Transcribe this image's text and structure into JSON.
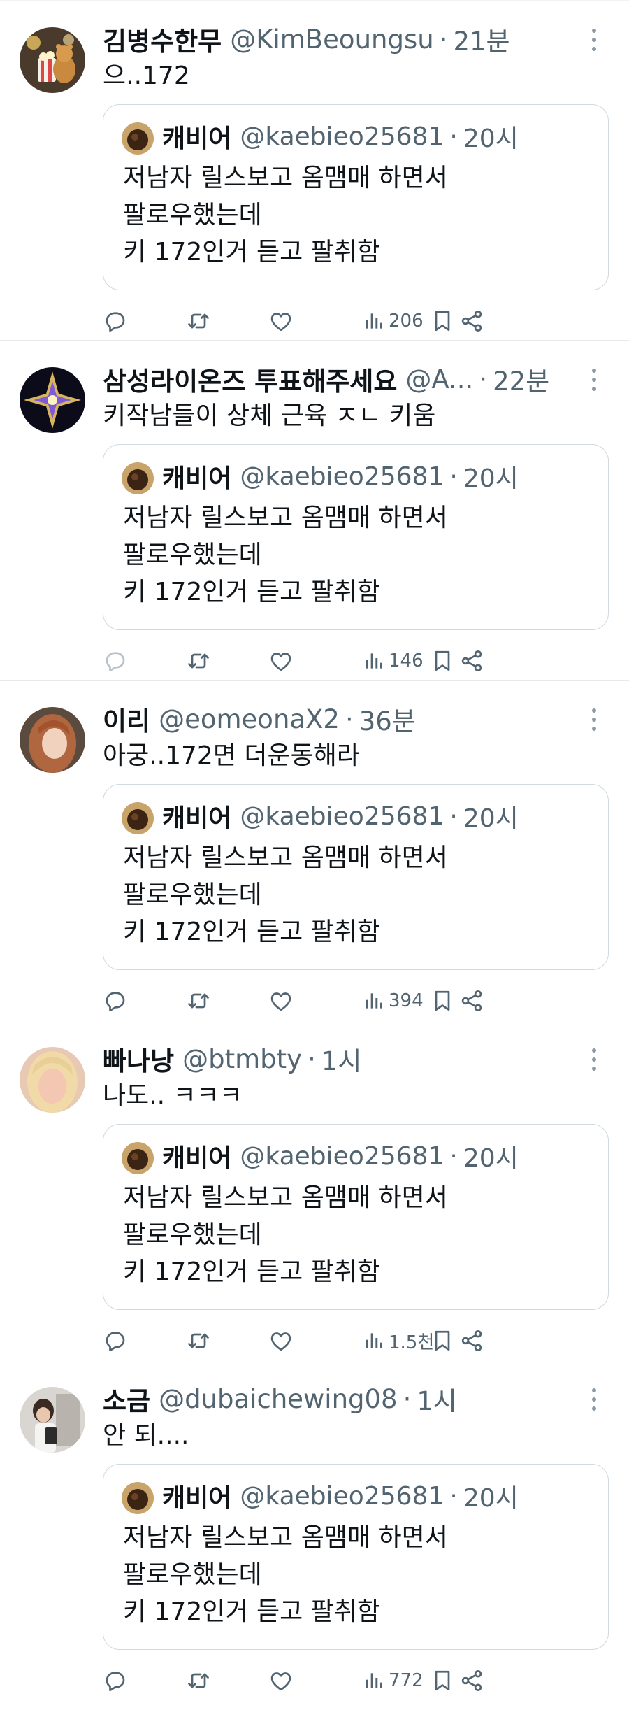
{
  "colors": {
    "text": "#0f1419",
    "secondary": "#536471",
    "border": "#cfd9de",
    "divider": "#e7e9ea"
  },
  "quoted": {
    "name": "캐비어",
    "handle": "@kaebieo25681",
    "separator": "·",
    "time": "20시",
    "lines": [
      "저남자 릴스보고 옴맴매 하면서",
      "팔로우했는데",
      "키 172인거 듣고 팔취함"
    ]
  },
  "posts": [
    {
      "name": "김병수한무",
      "handle": "@KimBeoungsu",
      "separator": "·",
      "time": "21분",
      "text": "으..172",
      "views": "206",
      "avatar_icon": "popcorn-bear-avatar"
    },
    {
      "name": "삼성라이온즈 투표해주세요",
      "handle": "@A...",
      "separator": "·",
      "time": "22분",
      "text": "키작남들이 상체 근육 ㅈㄴ 키움",
      "views": "146",
      "avatar_icon": "sparkle-star-avatar"
    },
    {
      "name": "이리",
      "handle": "@eomeonaX2",
      "separator": "·",
      "time": "36분",
      "text": "아궁..172면 더운동해라",
      "views": "394",
      "avatar_icon": "person-photo-avatar"
    },
    {
      "name": "빠나낭",
      "handle": "@btmbty",
      "separator": "·",
      "time": "1시",
      "text": "나도.. ㅋㅋㅋ",
      "views": "1.5천",
      "avatar_icon": "person-photo-avatar"
    },
    {
      "name": "소금",
      "handle": "@dubaichewing08",
      "separator": "·",
      "time": "1시",
      "text": "안 되....",
      "views": "772",
      "avatar_icon": "mirror-selfie-avatar"
    }
  ],
  "action_icons": [
    "reply-icon",
    "retweet-icon",
    "like-icon",
    "views-icon",
    "bookmark-icon",
    "share-icon"
  ]
}
